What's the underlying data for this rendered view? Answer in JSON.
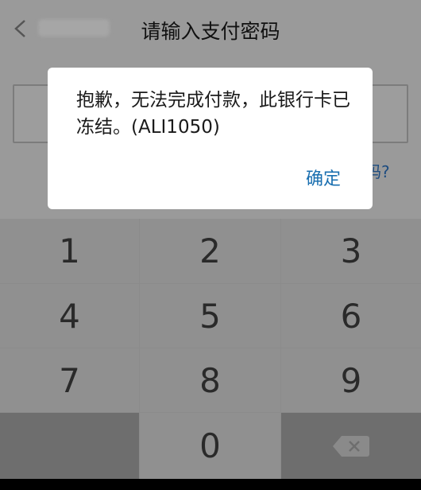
{
  "header": {
    "title": "请输入支付密码"
  },
  "password": {
    "forgot_link": "密码?"
  },
  "keypad": {
    "keys": [
      "1",
      "2",
      "3",
      "4",
      "5",
      "6",
      "7",
      "8",
      "9",
      "0"
    ]
  },
  "dialog": {
    "message": "抱歉，无法完成付款，此银行卡已冻结。(ALI1050)",
    "confirm_label": "确定"
  },
  "colors": {
    "dim_background": "#9a9a9a",
    "dialog_background": "#ffffff",
    "confirm_text": "#1a6fb0",
    "link_text": "#1d4c80"
  }
}
